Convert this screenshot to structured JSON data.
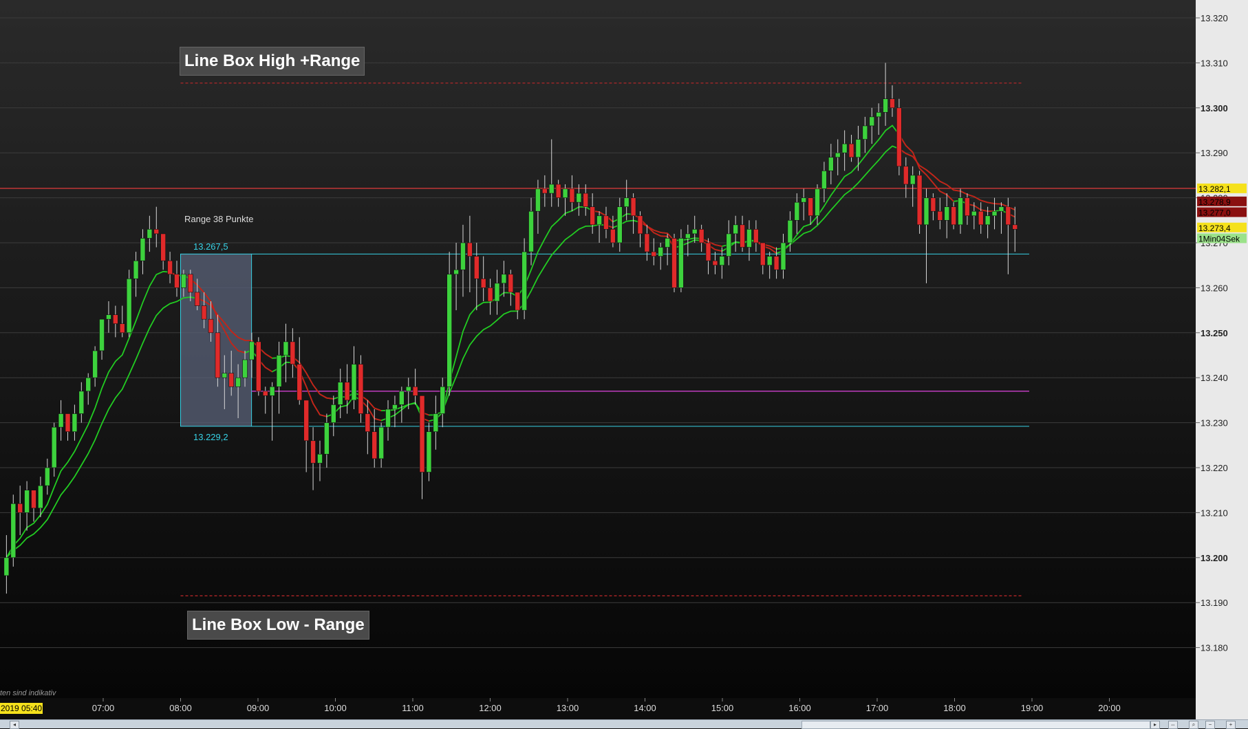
{
  "chart_data": {
    "type": "candlestick",
    "y_axis": {
      "min": 13171,
      "max": 13325,
      "ticks": [
        13320,
        13310,
        13300,
        13290,
        13280,
        13270,
        13260,
        13250,
        13240,
        13230,
        13220,
        13210,
        13200,
        13190,
        13180
      ],
      "tick_labels": [
        "13.320",
        "13.310",
        "13.300",
        "13.290",
        "13.280",
        "13.270",
        "13.260",
        "13.250",
        "13.240",
        "13.230",
        "13.220",
        "13.210",
        "13.200",
        "13.190",
        "13.180"
      ],
      "bold_ticks": [
        13300,
        13250,
        13200
      ]
    },
    "x_axis": {
      "start_hour": 5.6667,
      "end_hour": 21.1,
      "ticks": [
        7,
        8,
        9,
        10,
        11,
        12,
        13,
        14,
        15,
        16,
        17,
        18,
        19,
        20
      ],
      "tick_labels": [
        "07:00",
        "08:00",
        "09:00",
        "10:00",
        "11:00",
        "12:00",
        "13:00",
        "14:00",
        "15:00",
        "16:00",
        "17:00",
        "18:00",
        "19:00",
        "20:00"
      ],
      "start_label": "2019 05:40"
    },
    "price_tags": [
      {
        "label": "13.282,1",
        "value": 13282.1,
        "bg": "#f5e11c",
        "fg": "#000000"
      },
      {
        "label": "13.278,9",
        "value": 13279.2,
        "bg": "#8a1010",
        "fg": "#000000"
      },
      {
        "label": "13.277,0",
        "value": 13276.8,
        "bg": "#8a1010",
        "fg": "#000000"
      },
      {
        "label": "13.273,4",
        "value": 13273.4,
        "bg": "#f5e11c",
        "fg": "#000000"
      },
      {
        "label": "1Min04Sek",
        "value": 13271.0,
        "bg": "#9be28a",
        "fg": "#000000"
      }
    ],
    "levels": {
      "red_line": 13282.1,
      "box_high": 13267.5,
      "box_low": 13229.2,
      "magenta_line": 13237.0,
      "dashed_high": 13305.5,
      "dashed_low": 13191.5
    },
    "range_box": {
      "start_hour": 8.0,
      "end_hour": 8.9167
    },
    "annotations": {
      "line_box_high": "Line Box High +Range",
      "line_box_low": "Line Box Low - Range",
      "range_label": "Range 38 Punkte",
      "box_high_label": "13.267,5",
      "box_low_label": "13.229,2"
    },
    "footnote": "ten sind indikativ",
    "colors": {
      "up": "#3dd23d",
      "down": "#e02a2a",
      "ema_green": "#22cc22",
      "ema_red": "#cc1a1a",
      "cyan": "#37d2e6",
      "magenta": "#d040d0",
      "red_line": "#e03a3a"
    },
    "candles": [
      [
        13196,
        13205,
        13192,
        13200
      ],
      [
        13200,
        13214,
        13198,
        13212
      ],
      [
        13212,
        13216,
        13205,
        13210
      ],
      [
        13210,
        13217,
        13206,
        13215
      ],
      [
        13215,
        13214,
        13208,
        13211
      ],
      [
        13211,
        13218,
        13209,
        13216
      ],
      [
        13216,
        13222,
        13214,
        13220
      ],
      [
        13220,
        13230,
        13218,
        13229
      ],
      [
        13229,
        13235,
        13226,
        13232
      ],
      [
        13232,
        13230,
        13226,
        13228
      ],
      [
        13228,
        13234,
        13226,
        13232
      ],
      [
        13232,
        13239,
        13230,
        13237
      ],
      [
        13237,
        13241,
        13234,
        13240
      ],
      [
        13240,
        13247,
        13238,
        13246
      ],
      [
        13246,
        13253,
        13244,
        13253
      ],
      [
        13253,
        13257,
        13250,
        13254
      ],
      [
        13254,
        13256,
        13249,
        13252
      ],
      [
        13252,
        13256,
        13249,
        13250
      ],
      [
        13250,
        13264,
        13249,
        13262
      ],
      [
        13262,
        13268,
        13258,
        13266
      ],
      [
        13266,
        13273,
        13263,
        13271
      ],
      [
        13271,
        13276,
        13268,
        13273
      ],
      [
        13273,
        13278,
        13269,
        13272
      ],
      [
        13272,
        13271,
        13264,
        13266
      ],
      [
        13266,
        13268,
        13261,
        13263
      ],
      [
        13263,
        13266,
        13258,
        13260
      ],
      [
        13260,
        13264,
        13258,
        13263
      ],
      [
        13263,
        13264,
        13257,
        13259
      ],
      [
        13259,
        13262,
        13255,
        13256
      ],
      [
        13256,
        13259,
        13251,
        13253
      ],
      [
        13253,
        13257,
        13248,
        13250
      ],
      [
        13250,
        13254,
        13238,
        13240
      ],
      [
        13240,
        13245,
        13233,
        13241
      ],
      [
        13241,
        13246,
        13236,
        13238
      ],
      [
        13238,
        13243,
        13231,
        13240
      ],
      [
        13240,
        13246,
        13238,
        13244
      ],
      [
        13244,
        13250,
        13240,
        13248
      ],
      [
        13248,
        13249,
        13236,
        13237
      ],
      [
        13237,
        13238,
        13232,
        13236
      ],
      [
        13236,
        13239,
        13226,
        13238
      ],
      [
        13238,
        13248,
        13232,
        13245
      ],
      [
        13245,
        13252,
        13239,
        13248
      ],
      [
        13248,
        13251,
        13240,
        13243
      ],
      [
        13243,
        13249,
        13234,
        13235
      ],
      [
        13235,
        13235,
        13219,
        13226
      ],
      [
        13226,
        13229,
        13215,
        13221
      ],
      [
        13221,
        13226,
        13217,
        13223
      ],
      [
        13223,
        13232,
        13220,
        13230
      ],
      [
        13230,
        13236,
        13227,
        13234
      ],
      [
        13234,
        13242,
        13231,
        13239
      ],
      [
        13239,
        13243,
        13232,
        13235
      ],
      [
        13235,
        13247,
        13233,
        13243
      ],
      [
        13243,
        13245,
        13230,
        13232
      ],
      [
        13232,
        13235,
        13223,
        13228
      ],
      [
        13228,
        13233,
        13220,
        13222
      ],
      [
        13222,
        13230,
        13220,
        13229
      ],
      [
        13229,
        13235,
        13226,
        13233
      ],
      [
        13233,
        13236,
        13229,
        13234
      ],
      [
        13234,
        13238,
        13230,
        13237
      ],
      [
        13237,
        13240,
        13233,
        13238
      ],
      [
        13238,
        13242,
        13234,
        13236
      ],
      [
        13236,
        13236,
        13213,
        13219
      ],
      [
        13219,
        13230,
        13217,
        13228
      ],
      [
        13228,
        13236,
        13224,
        13232
      ],
      [
        13232,
        13240,
        13229,
        13238
      ],
      [
        13238,
        13268,
        13236,
        13263
      ],
      [
        13263,
        13270,
        13255,
        13264
      ],
      [
        13264,
        13274,
        13258,
        13270
      ],
      [
        13270,
        13276,
        13259,
        13267
      ],
      [
        13267,
        13270,
        13255,
        13262
      ],
      [
        13262,
        13267,
        13257,
        13260
      ],
      [
        13260,
        13262,
        13254,
        13257
      ],
      [
        13257,
        13264,
        13254,
        13261
      ],
      [
        13261,
        13266,
        13258,
        13263
      ],
      [
        13263,
        13264,
        13256,
        13259
      ],
      [
        13259,
        13258,
        13253,
        13255
      ],
      [
        13255,
        13271,
        13253,
        13268
      ],
      [
        13268,
        13280,
        13265,
        13277
      ],
      [
        13277,
        13284,
        13272,
        13282
      ],
      [
        13282,
        13285,
        13278,
        13281
      ],
      [
        13281,
        13293,
        13278,
        13283
      ],
      [
        13283,
        13284,
        13278,
        13280
      ],
      [
        13280,
        13283,
        13276,
        13282
      ],
      [
        13282,
        13285,
        13277,
        13279
      ],
      [
        13279,
        13283,
        13276,
        13281
      ],
      [
        13281,
        13283,
        13276,
        13278
      ],
      [
        13278,
        13281,
        13272,
        13274
      ],
      [
        13274,
        13277,
        13270,
        13276
      ],
      [
        13276,
        13278,
        13271,
        13273
      ],
      [
        13273,
        13276,
        13269,
        13270
      ],
      [
        13270,
        13280,
        13268,
        13278
      ],
      [
        13278,
        13284,
        13275,
        13280
      ],
      [
        13280,
        13281,
        13272,
        13276
      ],
      [
        13276,
        13277,
        13269,
        13272
      ],
      [
        13272,
        13274,
        13266,
        13268
      ],
      [
        13268,
        13271,
        13265,
        13267
      ],
      [
        13267,
        13270,
        13264,
        13269
      ],
      [
        13269,
        13272,
        13265,
        13271
      ],
      [
        13271,
        13272,
        13259,
        13260
      ],
      [
        13260,
        13273,
        13259,
        13271
      ],
      [
        13271,
        13274,
        13267,
        13272
      ],
      [
        13272,
        13276,
        13270,
        13273
      ],
      [
        13273,
        13274,
        13268,
        13270
      ],
      [
        13270,
        13271,
        13263,
        13266
      ],
      [
        13266,
        13268,
        13263,
        13265
      ],
      [
        13265,
        13269,
        13262,
        13267
      ],
      [
        13267,
        13275,
        13265,
        13272
      ],
      [
        13272,
        13276,
        13268,
        13274
      ],
      [
        13274,
        13276,
        13268,
        13269
      ],
      [
        13269,
        13275,
        13266,
        13273
      ],
      [
        13273,
        13275,
        13268,
        13270
      ],
      [
        13270,
        13270,
        13263,
        13265
      ],
      [
        13265,
        13268,
        13262,
        13267
      ],
      [
        13267,
        13269,
        13262,
        13264
      ],
      [
        13264,
        13272,
        13262,
        13270
      ],
      [
        13270,
        13277,
        13268,
        13275
      ],
      [
        13275,
        13281,
        13272,
        13279
      ],
      [
        13279,
        13282,
        13275,
        13280
      ],
      [
        13280,
        13278,
        13274,
        13276
      ],
      [
        13276,
        13283,
        13274,
        13282
      ],
      [
        13282,
        13288,
        13279,
        13286
      ],
      [
        13286,
        13292,
        13283,
        13289
      ],
      [
        13289,
        13293,
        13285,
        13290
      ],
      [
        13290,
        13295,
        13286,
        13292
      ],
      [
        13292,
        13294,
        13288,
        13289
      ],
      [
        13289,
        13296,
        13286,
        13293
      ],
      [
        13293,
        13298,
        13290,
        13296
      ],
      [
        13296,
        13300,
        13292,
        13298
      ],
      [
        13298,
        13301,
        13294,
        13299
      ],
      [
        13299,
        13310,
        13296,
        13302
      ],
      [
        13302,
        13305,
        13298,
        13300
      ],
      [
        13300,
        13302,
        13285,
        13287
      ],
      [
        13287,
        13289,
        13280,
        13283
      ],
      [
        13283,
        13287,
        13278,
        13285
      ],
      [
        13285,
        13286,
        13272,
        13274
      ],
      [
        13274,
        13282,
        13261,
        13280
      ],
      [
        13280,
        13281,
        13275,
        13277
      ],
      [
        13277,
        13280,
        13273,
        13275
      ],
      [
        13275,
        13281,
        13271,
        13278
      ],
      [
        13278,
        13279,
        13273,
        13274
      ],
      [
        13274,
        13282,
        13272,
        13280
      ],
      [
        13280,
        13281,
        13274,
        13276
      ],
      [
        13276,
        13279,
        13273,
        13277
      ],
      [
        13277,
        13279,
        13272,
        13274
      ],
      [
        13274,
        13278,
        13271,
        13276
      ],
      [
        13276,
        13280,
        13273,
        13277
      ],
      [
        13277,
        13279,
        13272,
        13278
      ],
      [
        13278,
        13280,
        13263,
        13274
      ],
      [
        13274,
        13278,
        13268,
        13273
      ]
    ]
  }
}
